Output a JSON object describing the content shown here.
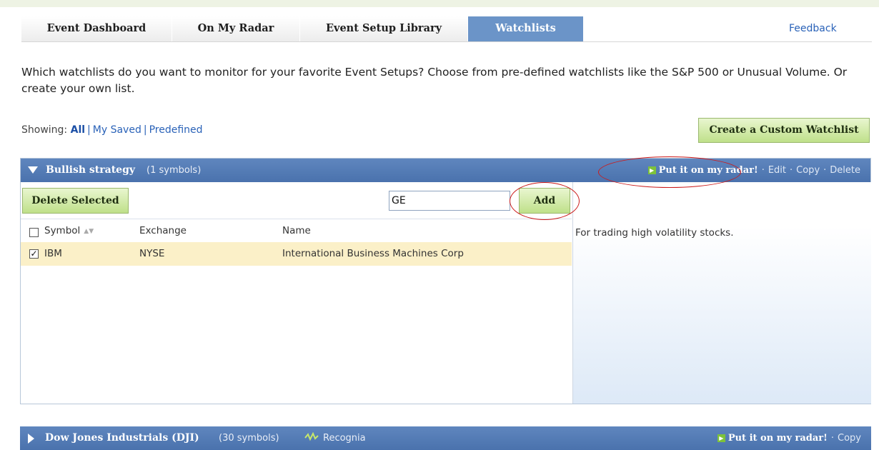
{
  "tabs": [
    {
      "label": "Event Dashboard",
      "active": false
    },
    {
      "label": "On My Radar",
      "active": false
    },
    {
      "label": "Event Setup Library",
      "active": false
    },
    {
      "label": "Watchlists",
      "active": true
    }
  ],
  "feedback_label": "Feedback",
  "intro_text": "Which watchlists do you want to monitor for your favorite Event Setups? Choose from pre-defined watchlists like the S&P 500 or Unusual Volume. Or create your own list.",
  "filter": {
    "label": "Showing:",
    "options": [
      "All",
      "My Saved",
      "Predefined"
    ],
    "selected": "All"
  },
  "create_button_label": "Create a Custom Watchlist",
  "watchlist": {
    "name": "Bullish strategy",
    "count_text": "(1 symbols)",
    "expanded": true,
    "actions": {
      "radar_label": "Put it on my radar!",
      "edit_label": "Edit",
      "copy_label": "Copy",
      "delete_label": "Delete"
    },
    "delete_selected_label": "Delete Selected",
    "symbol_input_value": "GE",
    "add_label": "Add",
    "columns": [
      "Symbol",
      "Exchange",
      "Name"
    ],
    "rows": [
      {
        "symbol": "IBM",
        "exchange": "NYSE",
        "name": "International Business Machines Corp",
        "checked": true
      }
    ],
    "description": "For trading high volatility stocks."
  },
  "watchlist2": {
    "name": "Dow Jones Industrials (DJI)",
    "count_text": "(30 symbols)",
    "provider": "Recognia",
    "expanded": false,
    "actions": {
      "radar_label": "Put it on my radar!",
      "copy_label": "Copy"
    }
  },
  "colors": {
    "tab_active": "#6b94c8",
    "header_blue": "#5075af",
    "button_green": "#cce8a0",
    "row_highlight": "#fbf0c8",
    "annotation_red": "#cc1a1a",
    "link_blue": "#2a62b8"
  }
}
